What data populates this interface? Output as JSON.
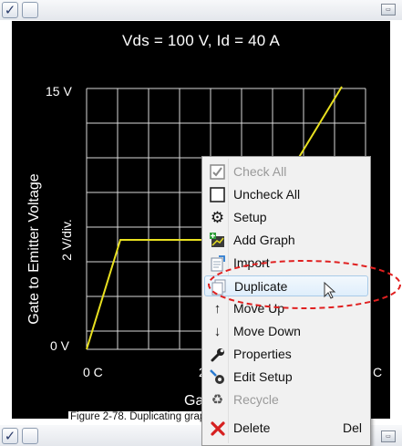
{
  "plot": {
    "title": "Vds = 100 V, Id = 40 A",
    "y_axis_label": "Gate to Emitter Voltage",
    "y_scale": "2  V/div.",
    "y_top_label": "15  V",
    "y_bottom_label": "0  V",
    "x_left_label": "0  C",
    "x_mid_partial": "2",
    "x_right_partial": "C",
    "x_axis_label_partial": "Ga",
    "trace_color": "#e8e020"
  },
  "context_menu": {
    "items": [
      {
        "label": "Check All",
        "icon": "checked-box-icon",
        "enabled": false
      },
      {
        "label": "Uncheck All",
        "icon": "empty-box-icon",
        "enabled": true
      },
      {
        "label": "Setup",
        "icon": "gear-icon",
        "enabled": true
      },
      {
        "label": "Add Graph",
        "icon": "add-graph-icon",
        "enabled": true
      },
      {
        "label": "Import",
        "icon": "import-icon",
        "enabled": true
      },
      {
        "label": "Duplicate",
        "icon": "duplicate-icon",
        "enabled": true,
        "highlighted": true
      },
      {
        "label": "Move Up",
        "icon": "arrow-up-icon",
        "enabled": true
      },
      {
        "label": "Move Down",
        "icon": "arrow-down-icon",
        "enabled": true
      },
      {
        "label": "Properties",
        "icon": "wrench-icon",
        "enabled": true
      },
      {
        "label": "Edit Setup",
        "icon": "edit-setup-icon",
        "enabled": true
      },
      {
        "label": "Recycle",
        "icon": "recycle-icon",
        "enabled": false
      },
      {
        "label": "Delete",
        "icon": "delete-x-icon",
        "enabled": true,
        "shortcut": "Del"
      }
    ]
  },
  "caption": "Figure 2-78. Duplicating graph setup.",
  "toolbar": {
    "checkbox_checked": "✓"
  },
  "annotation_color": "#e02020"
}
